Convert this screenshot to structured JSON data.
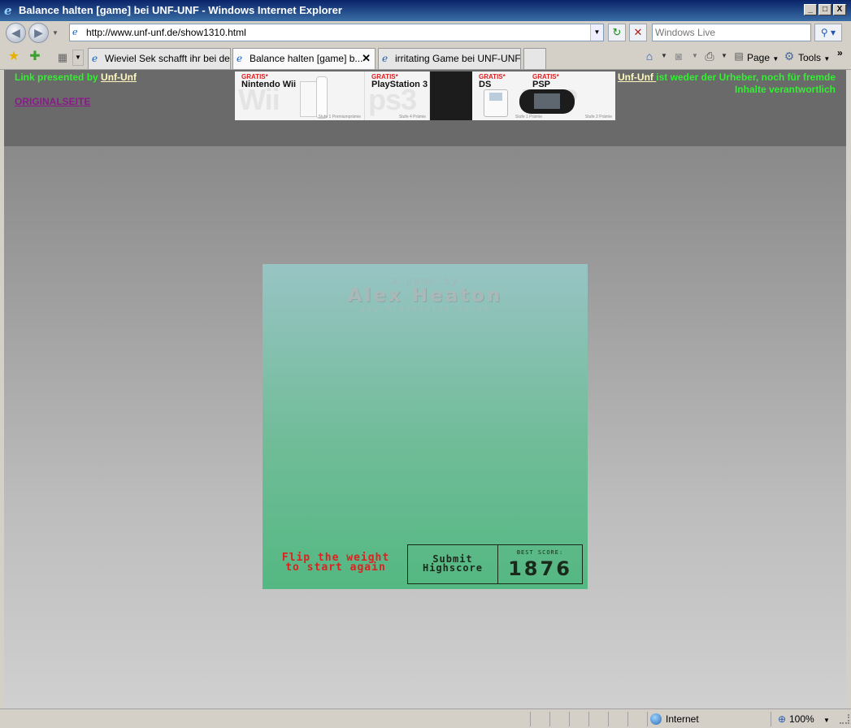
{
  "window": {
    "title": "Balance halten [game] bei UNF-UNF - Windows Internet Explorer",
    "buttons": [
      "_",
      "□",
      "X"
    ]
  },
  "toolbar": {
    "url": "http://www.unf-unf.de/show1310.html",
    "search_placeholder": "Windows Live"
  },
  "tabs": [
    {
      "label": "Wieviel Sek schafft ihr bei de...",
      "active": false
    },
    {
      "label": "Balance halten [game] b...",
      "active": true,
      "close": "✕"
    },
    {
      "label": "irritating Game bei UNF-UNF",
      "active": false
    }
  ],
  "commandbar": {
    "page_label": "Page",
    "tools_label": "Tools",
    "more": "»"
  },
  "header": {
    "link_presented_prefix": "Link presented by ",
    "link_presented_link": "Unf-Unf",
    "original_link": "ORIGINALSEITE",
    "disclaimer_link": "Unf-Unf ",
    "disclaimer_text": "ist weder der Urheber, noch für fremde Inhalte verantwortlich"
  },
  "banner": {
    "items": [
      {
        "badge": "GRATIS*",
        "name": "Nintendo Wii",
        "watermark": "Wii",
        "note": "Stufe 1 Premiumprämie"
      },
      {
        "badge": "GRATIS*",
        "name": "PlayStation 3",
        "watermark": "ps3",
        "note": "Stufe 4 Prämie"
      },
      {
        "badge": "GRATIS*",
        "name": "DS",
        "watermark": "DS",
        "note": "Stufe 1 Prämie"
      },
      {
        "badge": "GRATIS*",
        "name": "PSP",
        "watermark": "PSP",
        "note": "Stufe 2 Prämie"
      }
    ]
  },
  "game": {
    "credit_line1": "a game by",
    "credit_line2": "Alex Heaton",
    "credit_line3": "www.AlexHeaton.co.uk",
    "flip_line1": "Flip the weight",
    "flip_line2": "to start again",
    "submit_line1": "Submit",
    "submit_line2": "Highscore",
    "best_label": "BEST SCORE:",
    "best_value": "1876"
  },
  "statusbar": {
    "zone": "Internet",
    "zoom": "100%"
  },
  "colors": {
    "header_link_green": "#33ee33",
    "link_yellow": "#fff9c0",
    "original_link": "#8a1a8a",
    "game_red": "#e02020"
  }
}
